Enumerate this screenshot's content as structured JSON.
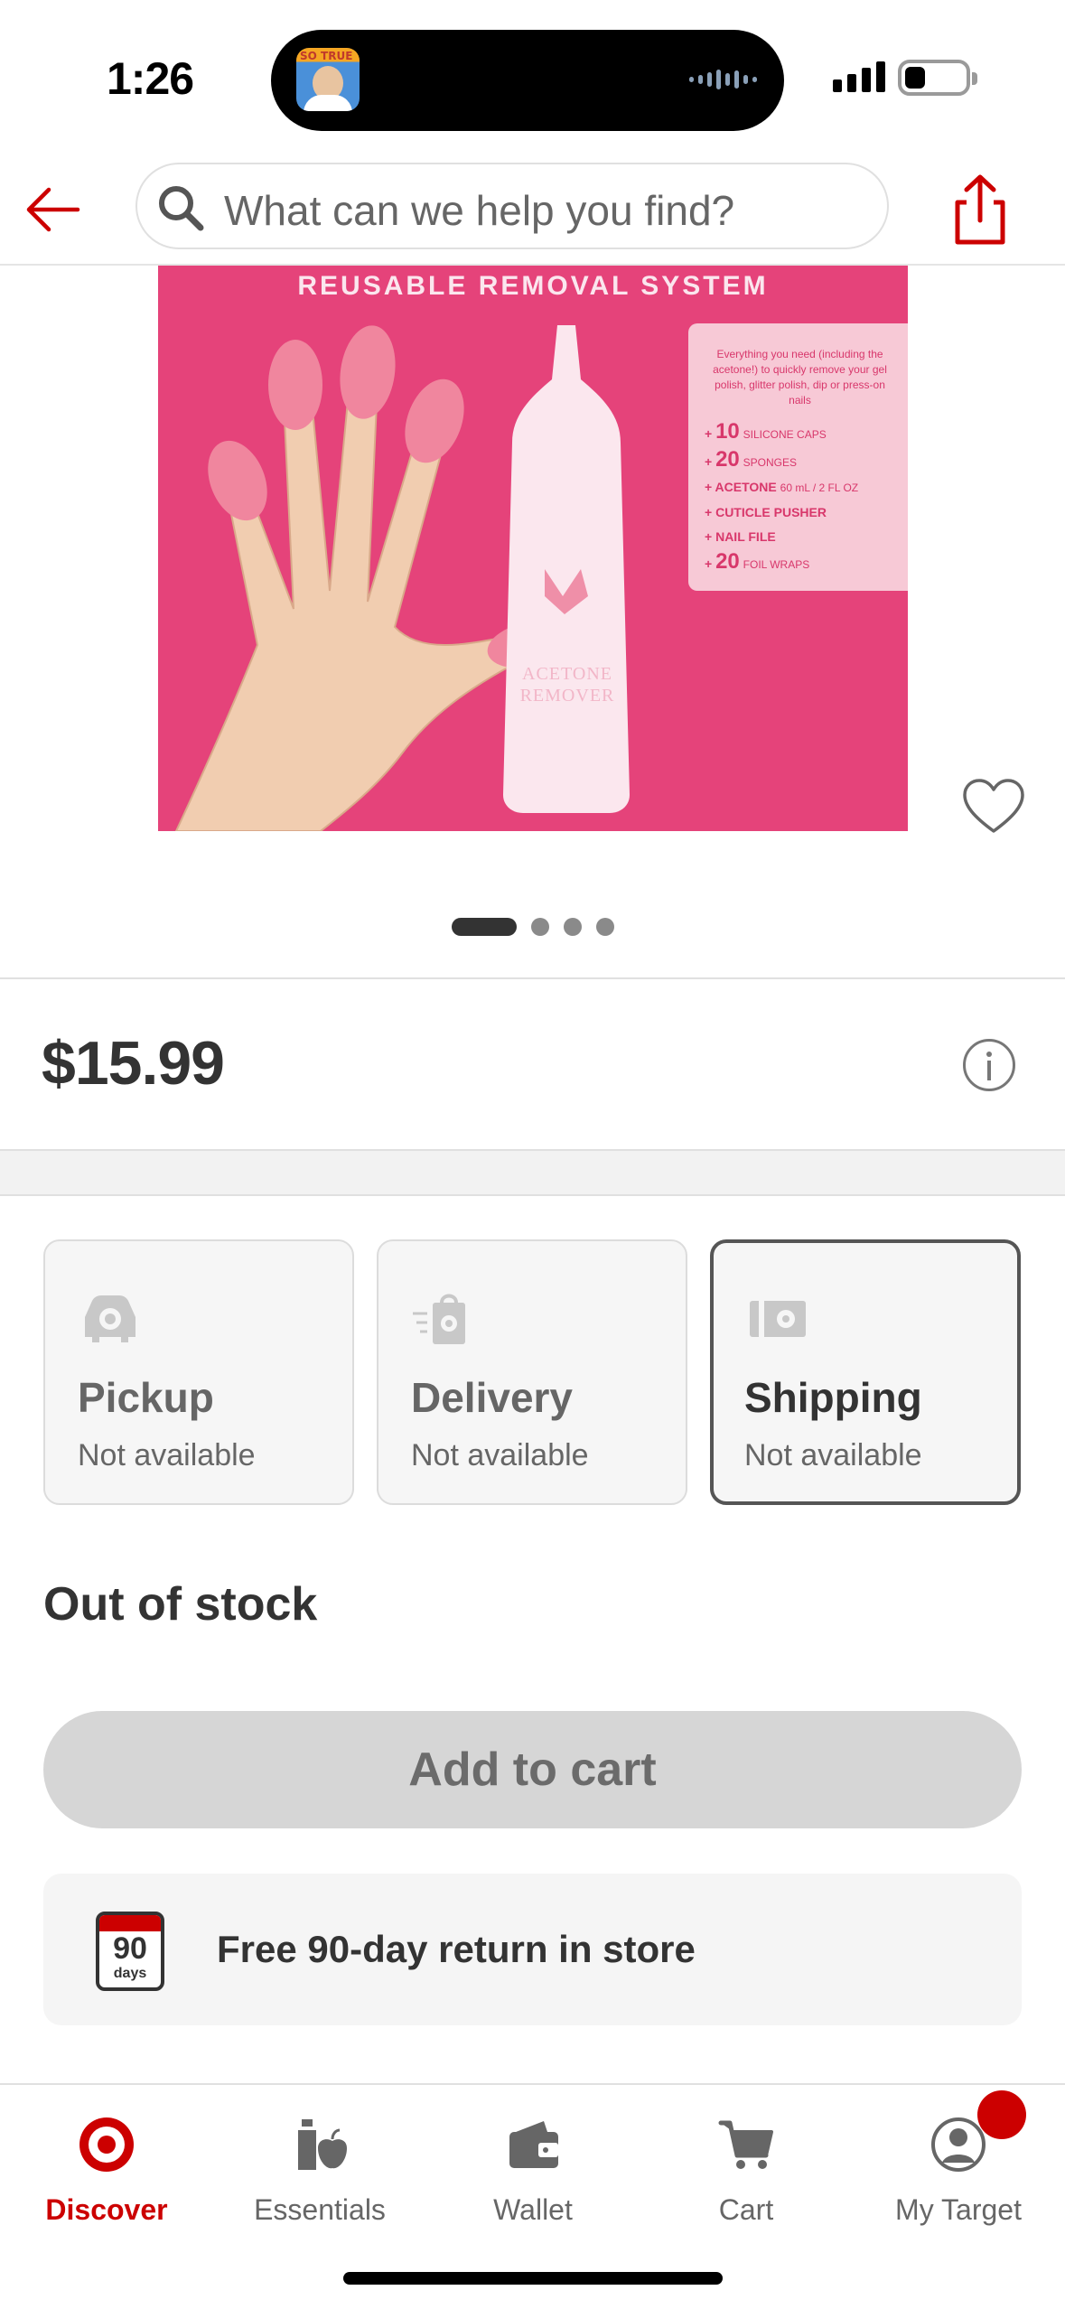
{
  "status_bar": {
    "time": "1:26",
    "island_tag": "SO TRUE"
  },
  "header": {
    "search_placeholder": "What can we help you find?",
    "back_icon": "arrow-left-icon",
    "share_icon": "share-icon",
    "accent_color": "#cc0000"
  },
  "product_image": {
    "title": "REUSABLE REMOVAL SYSTEM",
    "bottle_label": "ACETONE REMOVER",
    "intro": "Everything you need (including the acetone!) to quickly remove your gel polish, glitter polish, dip or press-on nails",
    "items": [
      {
        "num": "10",
        "text": "SILICONE CAPS",
        "small": true
      },
      {
        "num": "20",
        "text": "SPONGES",
        "small": true
      },
      {
        "num": "",
        "text": "ACETONE",
        "extra": "60 mL / 2 FL OZ"
      },
      {
        "num": "",
        "text": "CUTICLE PUSHER"
      },
      {
        "num": "",
        "text": "NAIL FILE"
      },
      {
        "num": "20",
        "text": "FOIL WRAPS",
        "small": true
      }
    ],
    "carousel": {
      "count": 4,
      "active": 0
    }
  },
  "price": "$15.99",
  "fulfillment": [
    {
      "title": "Pickup",
      "status": "Not available",
      "icon": "pickup-car-icon",
      "selected": false
    },
    {
      "title": "Delivery",
      "status": "Not available",
      "icon": "delivery-bag-icon",
      "selected": false
    },
    {
      "title": "Shipping",
      "status": "Not available",
      "icon": "shipping-box-icon",
      "selected": true
    }
  ],
  "stock_status": "Out of stock",
  "add_to_cart": "Add to cart",
  "returns": {
    "text": "Free 90-day return in store",
    "cal_num": "90",
    "cal_days": "days"
  },
  "tabs": [
    {
      "label": "Discover",
      "icon": "target-bullseye-icon",
      "active": true
    },
    {
      "label": "Essentials",
      "icon": "essentials-icon",
      "active": false
    },
    {
      "label": "Wallet",
      "icon": "wallet-icon",
      "active": false
    },
    {
      "label": "Cart",
      "icon": "cart-icon",
      "active": false
    },
    {
      "label": "My Target",
      "icon": "profile-icon",
      "active": false
    }
  ]
}
